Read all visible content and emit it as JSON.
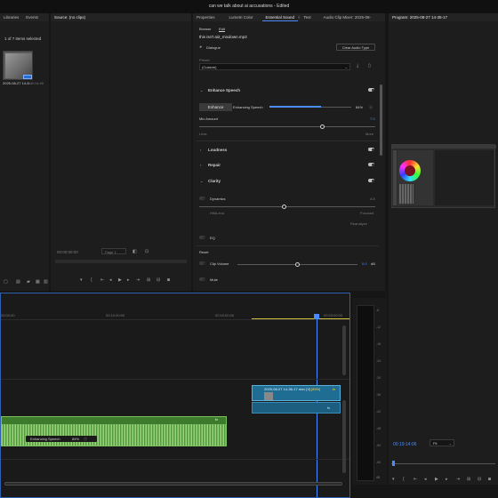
{
  "window": {
    "title": "can we talk about ai accusations - Edited"
  },
  "project_panel": {
    "tabs": [
      "Libraries",
      "Events"
    ],
    "item_count": "1 of 7 items selected",
    "clip_name": "2025-08-27 14-3...",
    "clip_duration": "0:09:14:49"
  },
  "source_panel": {
    "tab": "Source: (no clips)",
    "timecode": "00:00:00:00",
    "page_label": "Page 1"
  },
  "right_tabs": [
    "Properties",
    "Lumetri Color",
    "Essential Sound",
    "Text",
    "Audio Clip Mixer: 2025-08-"
  ],
  "essential_sound": {
    "subtabs": [
      "Browse",
      "Edit"
    ],
    "filename": "this isn't ai2_mixdown.mp3",
    "clip_type": "Dialogue",
    "clear_button": "Clear Audio Type",
    "preset_label": "Preset",
    "preset_value": "(Custom)",
    "enhance_speech": {
      "title": "Enhance Speech",
      "button": "Enhance",
      "label": "Enhancing Speech",
      "percent": "84%",
      "progress": 0.84
    },
    "mix_amount": {
      "label": "Mix Amount",
      "value": "7.0",
      "less": "Less",
      "more": "More",
      "level": 0.7
    },
    "loudness": "Loudness",
    "repair": "Repair",
    "clarity": "Clarity",
    "dynamics": {
      "label": "Dynamics",
      "value": "4.8",
      "left": "Hifid-end",
      "right": "Focused",
      "reset": "Reanalyze",
      "level": 0.48
    },
    "eq": "EQ",
    "reverb_label": "Reset",
    "clip_volume": {
      "label": "Clip Volume",
      "value": "0.0",
      "unit": "dB",
      "level": 0.5
    },
    "mute": "Mute"
  },
  "program_panel": {
    "tab": "Program: 2025-08-27 14-35-17",
    "timecode": "00:19:14:06",
    "fit": "Fit"
  },
  "timeline": {
    "ruler": [
      "00:00:00",
      "00:10:00:00",
      "00:15:00:00",
      "00:20:00:00"
    ],
    "clip_label": "2025-08-27 14-36-17.mov [V]",
    "clip_pct": "[85%]",
    "audio_label": "Enhancing Speech",
    "audio_pct": "84%",
    "meter_labels": [
      "-6",
      "-12",
      "-18",
      "-24",
      "-30",
      "-36",
      "-42",
      "-48",
      "-54",
      "-60",
      "dB"
    ]
  },
  "colors": {
    "accent": "#4a8cff",
    "clip_video": "#2a8fb8",
    "clip_audio": "#4f9a3a",
    "panel": "#1d1d1d"
  }
}
